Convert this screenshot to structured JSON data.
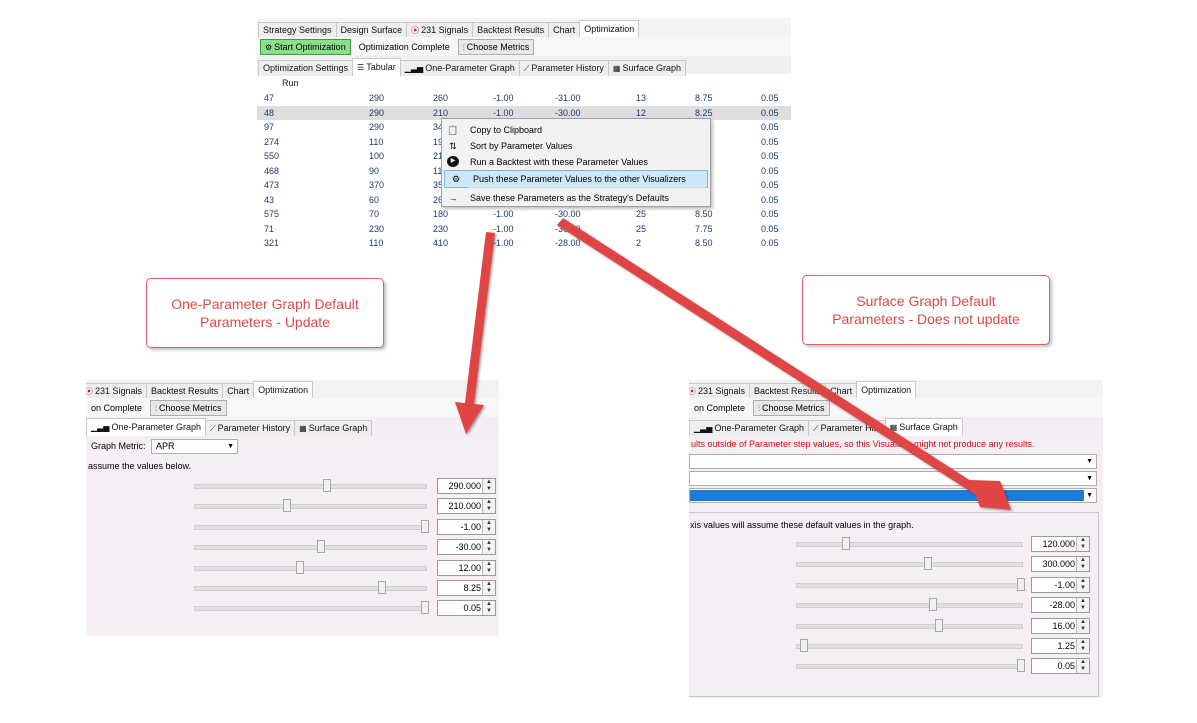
{
  "top": {
    "main_tabs": [
      "Strategy Settings",
      "Design Surface",
      "231 Signals",
      "Backtest Results",
      "Chart",
      "Optimization"
    ],
    "buttons": {
      "start": "Start Optimization",
      "status": "Optimization Complete",
      "metrics": "Choose Metrics"
    },
    "sub_tabs": [
      "Optimization Settings",
      "Tabular",
      "One-Parameter Graph",
      "Parameter History",
      "Surface Graph"
    ],
    "header": "Run",
    "rows": [
      [
        "47",
        "290",
        "260",
        "-1.00",
        "-31.00",
        "13",
        "8.75",
        "0.05"
      ],
      [
        "48",
        "290",
        "210",
        "-1.00",
        "-30.00",
        "12",
        "8.25",
        "0.05"
      ],
      [
        "97",
        "290",
        "34",
        "",
        "",
        "",
        "",
        "0.05"
      ],
      [
        "274",
        "110",
        "19",
        "",
        "",
        "",
        "",
        "0.05"
      ],
      [
        "550",
        "100",
        "21",
        "",
        "",
        "",
        "",
        "0.05"
      ],
      [
        "468",
        "90",
        "11",
        "",
        "",
        "",
        "",
        "0.05"
      ],
      [
        "473",
        "370",
        "35",
        "",
        "",
        "",
        "",
        "0.05"
      ],
      [
        "43",
        "60",
        "26",
        "",
        "",
        "",
        "",
        "0.05"
      ],
      [
        "575",
        "70",
        "180",
        "-1.00",
        "-30.00",
        "25",
        "8.50",
        "0.05"
      ],
      [
        "71",
        "230",
        "230",
        "-1.00",
        "-30.00",
        "25",
        "7.75",
        "0.05"
      ],
      [
        "321",
        "110",
        "410",
        "-1.00",
        "-28.00",
        "2",
        "8.50",
        "0.05"
      ]
    ]
  },
  "context_menu": [
    {
      "icon": "clipboard-icon",
      "label": "Copy to Clipboard"
    },
    {
      "icon": "sort-icon",
      "label": "Sort by Parameter Values"
    },
    {
      "icon": "play-icon",
      "label": "Run a Backtest with these Parameter Values"
    },
    {
      "icon": "gears-icon",
      "label": "Push these Parameter Values to the other Visualizers"
    },
    {
      "icon": "arrow-right-icon",
      "label": "Save these Parameters as the Strategy's Defaults"
    }
  ],
  "callouts": {
    "left": [
      "One-Parameter Graph Default",
      "Parameters - Update"
    ],
    "right": [
      "Surface Graph Default",
      "Parameters - Does not update"
    ]
  },
  "left_panel": {
    "main_tabs": [
      "231 Signals",
      "Backtest Results",
      "Chart",
      "Optimization"
    ],
    "status": "on Complete",
    "metrics": "Choose Metrics",
    "sub_tabs": [
      "One-Parameter Graph",
      "Parameter History",
      "Surface Graph"
    ],
    "graph_metric_label": "Graph Metric:",
    "graph_metric_value": "APR",
    "note": "assume the values below.",
    "values": [
      "290.000",
      "210.000",
      "-1.00",
      "-30.00",
      "12.00",
      "8.25",
      "0.05"
    ],
    "thumbs": [
      0.57,
      0.39,
      1.0,
      0.54,
      0.45,
      0.81,
      1.0
    ]
  },
  "right_panel": {
    "main_tabs": [
      "231 Signals",
      "Backtest Results",
      "Chart",
      "Optimization"
    ],
    "status": "on Complete",
    "metrics": "Choose Metrics",
    "sub_tabs": [
      "One-Parameter Graph",
      "Parameter Hist",
      "Surface Graph"
    ],
    "warning": "ults outside of Parameter step values, so this Visualizer might not produce any results.",
    "note": "xis values will assume these default values in the graph.",
    "values": [
      "120.000",
      "300.000",
      "-1.00",
      "-28.00",
      "16.00",
      "1.25",
      "0.05"
    ],
    "thumbs": [
      0.21,
      0.58,
      1.0,
      0.6,
      0.63,
      0.02,
      1.0
    ]
  },
  "colors": {
    "accent_red": "#e04848",
    "arrow_red": "#e04444",
    "grid_text": "#1b3a6b",
    "selected_blue": "#1a7cd8"
  }
}
